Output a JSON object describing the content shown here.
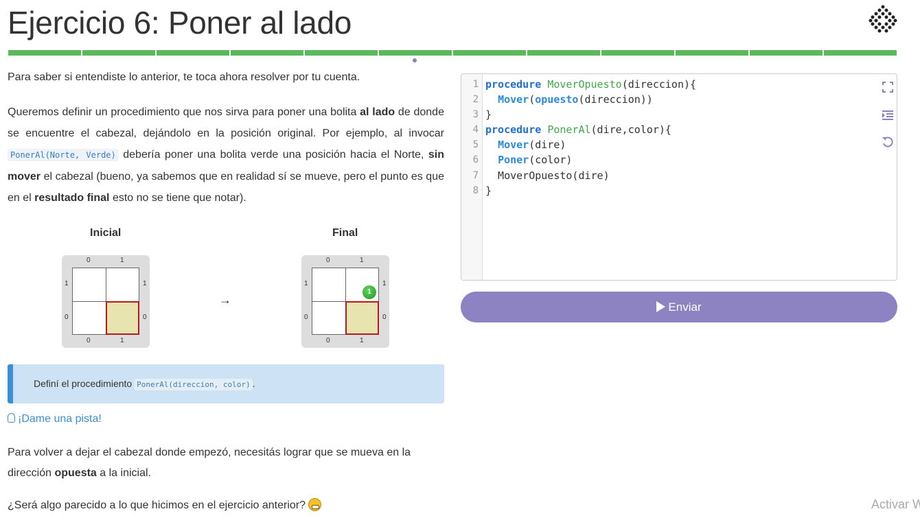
{
  "header": {
    "title": "Ejercicio 6: Poner al lado",
    "progress_segments": 12,
    "progress_color": "#5cb85c"
  },
  "content": {
    "intro": "Para saber si entendiste lo anterior, te toca ahora resolver por tu cuenta.",
    "para2": {
      "t1": "Queremos definir un procedimiento que nos sirva para poner una bolita ",
      "b1": "al lado",
      "t2": " de donde se encuentre el cabezal, dejándolo en la posición original. Por ejemplo, al invocar ",
      "code": "PonerAl(Norte, Verde)",
      "t3": " debería poner una bolita verde una posición hacia el Norte, ",
      "b2": "sin mover",
      "t4": " el cabezal (bueno, ya sabemos que en realidad sí se mueve, pero el punto es que en el ",
      "b3": "resultado final",
      "t5": " esto no se tiene que notar)."
    },
    "boards": {
      "initial_label": "Inicial",
      "final_label": "Final",
      "col_labels": [
        "0",
        "1"
      ],
      "row_labels": [
        "1",
        "0"
      ],
      "ball_count": "1",
      "ball_color": "#2ea52e",
      "head_color": "#c0151b",
      "arrow": "→"
    },
    "callout": {
      "text": "Definí el procedimiento ",
      "code": "PonerAl(direccion, color)",
      "end": "."
    },
    "hint_link": "¡Dame una pista!",
    "para3": {
      "t1": "Para volver a dejar el cabezal donde empezó, necesitás lograr que se mueva en la dirección ",
      "b1": "opuesta",
      "t2": " a la inicial."
    },
    "para4": "¿Será algo parecido a lo que hicimos en el ejercicio anterior?"
  },
  "editor": {
    "line_numbers": [
      "1",
      "2",
      "3",
      "4",
      "5",
      "6",
      "7",
      "8"
    ],
    "lines": {
      "l1": {
        "kw": "procedure",
        "sp": " ",
        "fn": "MoverOpuesto",
        "rest": "(direccion){"
      },
      "l2": {
        "ind": "  ",
        "bi": "Mover",
        "p": "(",
        "bi2": "opuesto",
        "rest": "(direccion))"
      },
      "l3": {
        "rest": "}"
      },
      "l4": {
        "kw": "procedure",
        "sp": " ",
        "fn": "PonerAl",
        "rest": "(dire,color){"
      },
      "l5": {
        "ind": "  ",
        "bi": "Mover",
        "rest": "(dire)"
      },
      "l6": {
        "ind": "  ",
        "bi": "Poner",
        "rest": "(color)"
      },
      "l7": {
        "rest": "  MoverOpuesto(dire)"
      },
      "l8": {
        "rest": "}"
      }
    },
    "icons": [
      "fullscreen-icon",
      "indent-icon",
      "reset-icon"
    ]
  },
  "submit": {
    "label": "Enviar",
    "color": "#8d83c2"
  },
  "watermark": "Activar W"
}
